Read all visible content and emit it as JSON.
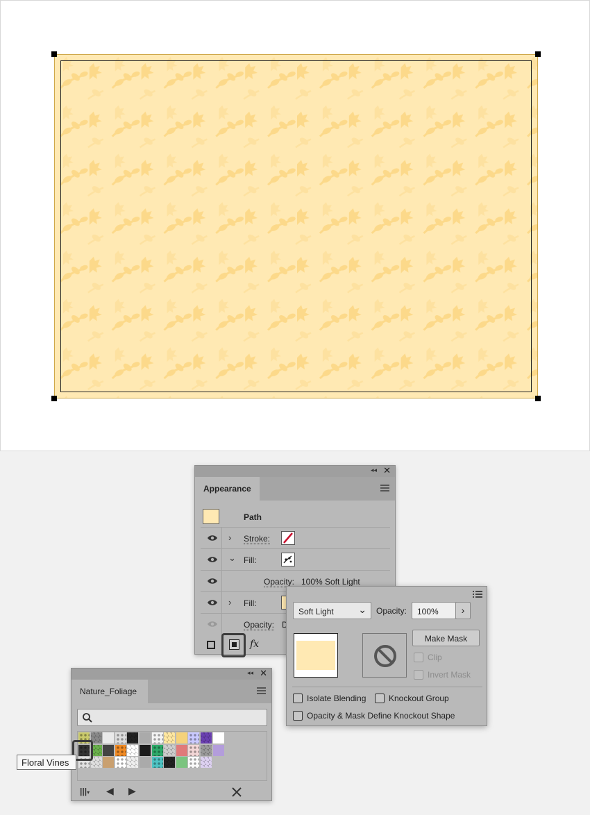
{
  "appearance": {
    "tab_label": "Appearance",
    "object_label": "Path",
    "rows": [
      {
        "label": "Stroke:",
        "extra": ""
      },
      {
        "label": "Fill:",
        "extra": ""
      },
      {
        "label": "Opacity:",
        "extra": "100% Soft Light"
      },
      {
        "label": "Fill:",
        "extra": ""
      },
      {
        "label": "Opacity:",
        "extra": "D"
      }
    ],
    "fx_label": "fx"
  },
  "transparency": {
    "blend_mode": "Soft Light",
    "opacity_label": "Opacity:",
    "opacity_value": "100%",
    "make_mask_label": "Make Mask",
    "clip_label": "Clip",
    "invert_mask_label": "Invert Mask",
    "isolate_blending_label": "Isolate Blending",
    "knockout_group_label": "Knockout Group",
    "opacity_mask_knockout_label": "Opacity & Mask Define Knockout Shape"
  },
  "swatches": {
    "tab_label": "Nature_Foliage",
    "tooltip": "Floral Vines"
  },
  "colors": {
    "pattern_bg": "#ffe9b3",
    "pattern_leaf": "#fcd98a",
    "panel_bg": "#b9b9b9"
  }
}
